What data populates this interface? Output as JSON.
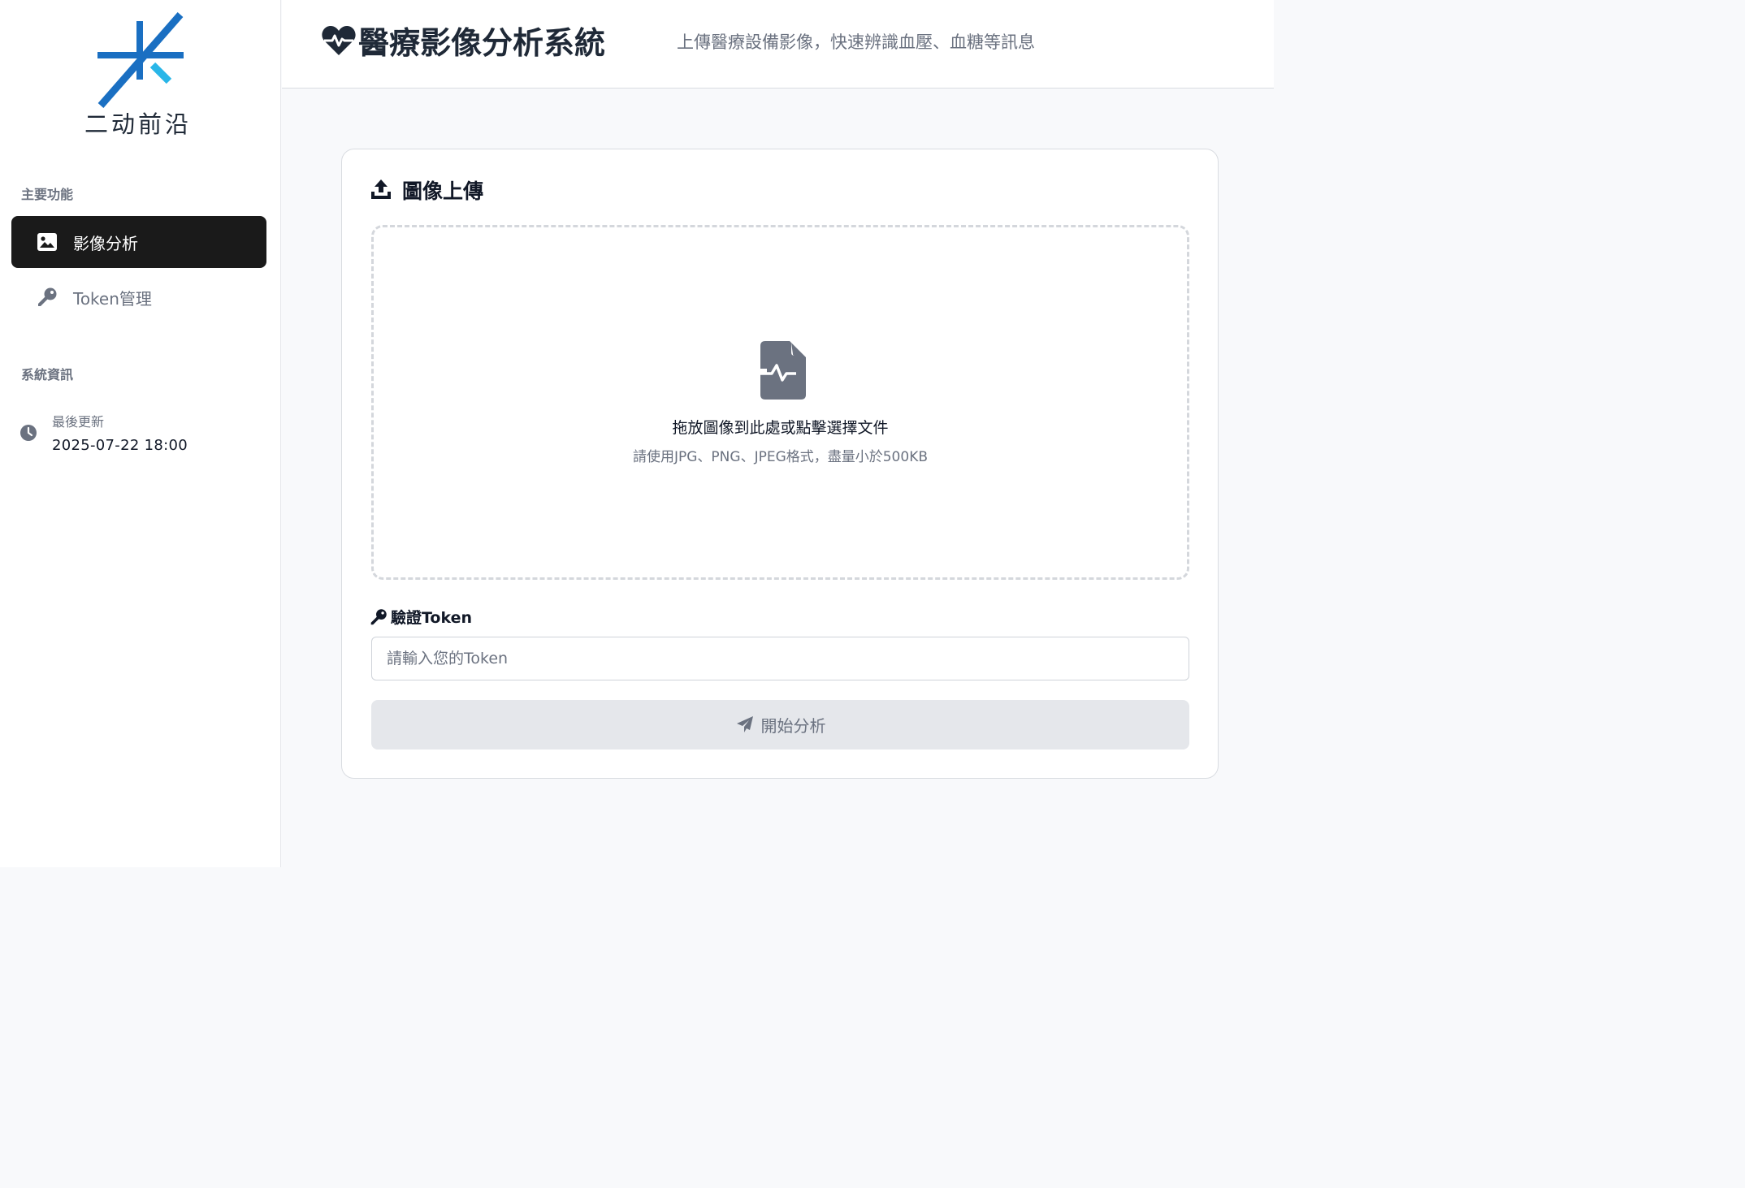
{
  "brand": {
    "logo_text": "二动前沿",
    "logo_icon": "asterisk-logo-icon",
    "colors": {
      "primary": "#1a6fc2",
      "accent": "#29b6e8"
    }
  },
  "sidebar": {
    "main_section_label": "主要功能",
    "items": [
      {
        "label": "影像分析",
        "icon": "image-icon",
        "active": true
      },
      {
        "label": "Token管理",
        "icon": "key-icon",
        "active": false
      }
    ],
    "system_section_label": "系統資訊",
    "last_update_label": "最後更新",
    "last_update_value": "2025-07-22 18:00"
  },
  "header": {
    "title": "醫療影像分析系統",
    "title_icon": "heart-pulse-icon",
    "subtitle": "上傳醫療設備影像，快速辨識血壓、血糖等訊息"
  },
  "upload_card": {
    "title": "圖像上傳",
    "title_icon": "upload-icon",
    "dropzone_text": "拖放圖像到此處或點擊選擇文件",
    "dropzone_hint": "請使用JPG、PNG、JPEG格式，盡量小於500KB",
    "dropzone_icon": "file-medical-icon",
    "token_label": "驗證Token",
    "token_placeholder": "請輸入您的Token",
    "token_value": "",
    "submit_label": "開始分析",
    "submit_icon": "paper-plane-icon"
  }
}
